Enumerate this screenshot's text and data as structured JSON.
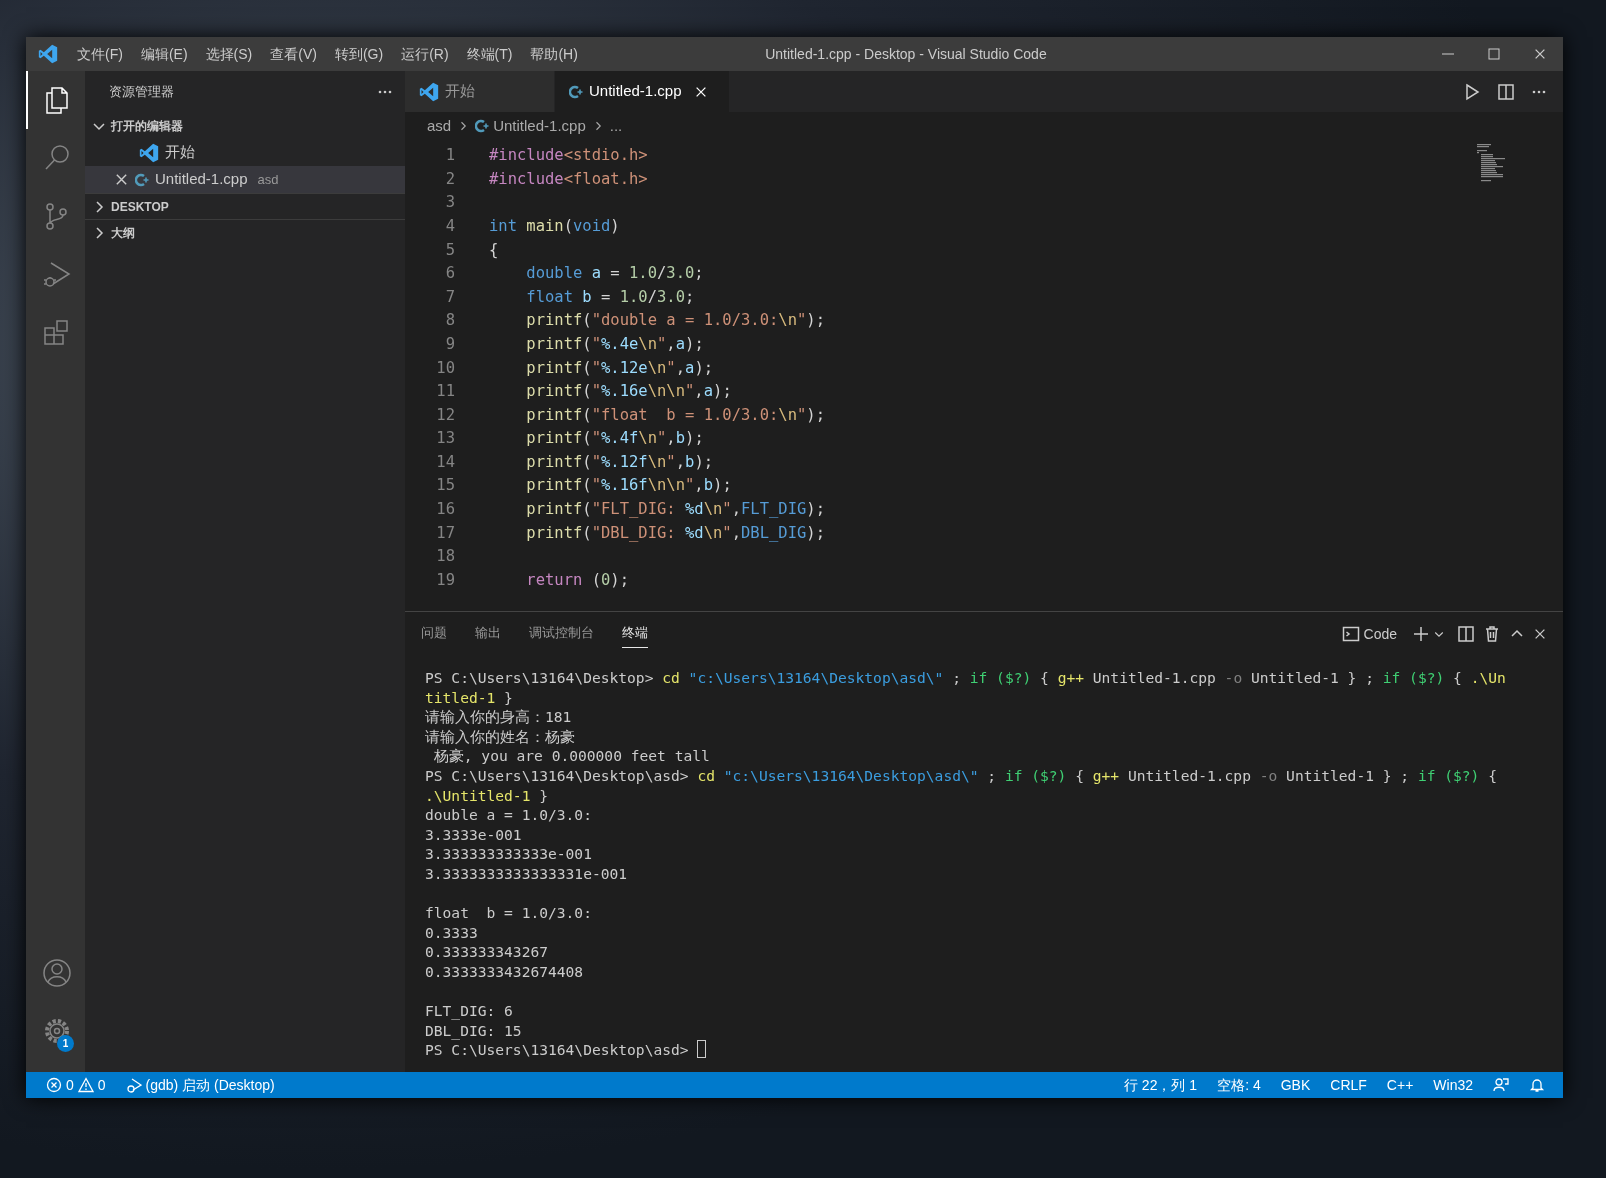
{
  "window": {
    "title": "Untitled-1.cpp - Desktop - Visual Studio Code"
  },
  "menu": [
    "文件(F)",
    "编辑(E)",
    "选择(S)",
    "查看(V)",
    "转到(G)",
    "运行(R)",
    "终端(T)",
    "帮助(H)"
  ],
  "activity_bar": {
    "top": [
      {
        "selected": true
      },
      {
        "selected": false
      },
      {
        "selected": false
      },
      {
        "selected": false
      },
      {
        "selected": false
      }
    ],
    "bottom": [
      {
        "selected": false
      },
      {
        "selected": false,
        "badge": "1"
      }
    ]
  },
  "sidebar": {
    "title": "资源管理器",
    "sections": [
      {
        "label": "打开的编辑器",
        "expanded": true,
        "items": [
          {
            "label": "开始",
            "kind": "welcome",
            "selected": false
          },
          {
            "label": "Untitled-1.cpp",
            "description": "asd",
            "kind": "cpp",
            "selected": true
          }
        ]
      },
      {
        "label": "DESKTOP",
        "expanded": false
      },
      {
        "label": "大纲",
        "expanded": false
      }
    ]
  },
  "tabs": [
    {
      "label": "开始",
      "kind": "welcome",
      "selected": false
    },
    {
      "label": "Untitled-1.cpp",
      "kind": "cpp",
      "selected": true
    }
  ],
  "breadcrumb": [
    {
      "text": "asd",
      "kind": "folder"
    },
    {
      "text": "Untitled-1.cpp",
      "kind": "cpp"
    },
    {
      "text": "...",
      "kind": "symbol"
    }
  ],
  "editor": {
    "lines": [
      {
        "number": "1",
        "tokens": [
          {
            "kind": "pre",
            "text": "#include"
          },
          {
            "kind": "str",
            "text": "<stdio.h>"
          }
        ]
      },
      {
        "number": "2",
        "tokens": [
          {
            "kind": "pre",
            "text": "#include"
          },
          {
            "kind": "str",
            "text": "<float.h>"
          }
        ]
      },
      {
        "number": "3"
      },
      {
        "number": "4",
        "tokens": [
          {
            "kind": "kw",
            "text": "int"
          },
          {
            "kind": "fn",
            "text": " main"
          },
          {
            "kind": "plain",
            "text": "("
          },
          {
            "kind": "kw",
            "text": "void"
          },
          {
            "kind": "plain",
            "text": ")"
          }
        ]
      },
      {
        "number": "5",
        "tokens": [
          {
            "kind": "plain",
            "text": "{"
          }
        ]
      },
      {
        "number": "6",
        "tokens": [
          {
            "kind": "kw",
            "text": "    double"
          },
          {
            "kind": "var",
            "text": " a"
          },
          {
            "kind": "plain",
            "text": " = "
          },
          {
            "kind": "num",
            "text": "1.0"
          },
          {
            "kind": "plain",
            "text": "/"
          },
          {
            "kind": "num",
            "text": "3.0"
          },
          {
            "kind": "plain",
            "text": ";"
          }
        ]
      },
      {
        "number": "7",
        "tokens": [
          {
            "kind": "kw",
            "text": "    float"
          },
          {
            "kind": "var",
            "text": " b"
          },
          {
            "kind": "plain",
            "text": " = "
          },
          {
            "kind": "num",
            "text": "1.0"
          },
          {
            "kind": "plain",
            "text": "/"
          },
          {
            "kind": "num",
            "text": "3.0"
          },
          {
            "kind": "plain",
            "text": ";"
          }
        ]
      },
      {
        "number": "8",
        "tokens": [
          {
            "kind": "fn",
            "text": "    printf"
          },
          {
            "kind": "plain",
            "text": "("
          },
          {
            "kind": "str",
            "text": "\"double a = 1.0/3.0:"
          },
          {
            "kind": "esc",
            "text": "\\n"
          },
          {
            "kind": "str",
            "text": "\""
          },
          {
            "kind": "plain",
            "text": ");"
          }
        ]
      },
      {
        "number": "9",
        "tokens": [
          {
            "kind": "fn",
            "text": "    printf"
          },
          {
            "kind": "plain",
            "text": "("
          },
          {
            "kind": "str",
            "text": "\""
          },
          {
            "kind": "fmt",
            "text": "%.4e"
          },
          {
            "kind": "esc",
            "text": "\\n"
          },
          {
            "kind": "str",
            "text": "\""
          },
          {
            "kind": "plain",
            "text": ","
          },
          {
            "kind": "var",
            "text": "a"
          },
          {
            "kind": "plain",
            "text": ");"
          }
        ]
      },
      {
        "number": "10",
        "tokens": [
          {
            "kind": "fn",
            "text": "    printf"
          },
          {
            "kind": "plain",
            "text": "("
          },
          {
            "kind": "str",
            "text": "\""
          },
          {
            "kind": "fmt",
            "text": "%.12e"
          },
          {
            "kind": "esc",
            "text": "\\n"
          },
          {
            "kind": "str",
            "text": "\""
          },
          {
            "kind": "plain",
            "text": ","
          },
          {
            "kind": "var",
            "text": "a"
          },
          {
            "kind": "plain",
            "text": ");"
          }
        ]
      },
      {
        "number": "11",
        "tokens": [
          {
            "kind": "fn",
            "text": "    printf"
          },
          {
            "kind": "plain",
            "text": "("
          },
          {
            "kind": "str",
            "text": "\""
          },
          {
            "kind": "fmt",
            "text": "%.16e"
          },
          {
            "kind": "esc",
            "text": "\\n\\n"
          },
          {
            "kind": "str",
            "text": "\""
          },
          {
            "kind": "plain",
            "text": ","
          },
          {
            "kind": "var",
            "text": "a"
          },
          {
            "kind": "plain",
            "text": ");"
          }
        ]
      },
      {
        "number": "12",
        "tokens": [
          {
            "kind": "fn",
            "text": "    printf"
          },
          {
            "kind": "plain",
            "text": "("
          },
          {
            "kind": "str",
            "text": "\"float  b = 1.0/3.0:"
          },
          {
            "kind": "esc",
            "text": "\\n"
          },
          {
            "kind": "str",
            "text": "\""
          },
          {
            "kind": "plain",
            "text": ");"
          }
        ]
      },
      {
        "number": "13",
        "tokens": [
          {
            "kind": "fn",
            "text": "    printf"
          },
          {
            "kind": "plain",
            "text": "("
          },
          {
            "kind": "str",
            "text": "\""
          },
          {
            "kind": "fmt",
            "text": "%.4f"
          },
          {
            "kind": "esc",
            "text": "\\n"
          },
          {
            "kind": "str",
            "text": "\""
          },
          {
            "kind": "plain",
            "text": ","
          },
          {
            "kind": "var",
            "text": "b"
          },
          {
            "kind": "plain",
            "text": ");"
          }
        ]
      },
      {
        "number": "14",
        "tokens": [
          {
            "kind": "fn",
            "text": "    printf"
          },
          {
            "kind": "plain",
            "text": "("
          },
          {
            "kind": "str",
            "text": "\""
          },
          {
            "kind": "fmt",
            "text": "%.12f"
          },
          {
            "kind": "esc",
            "text": "\\n"
          },
          {
            "kind": "str",
            "text": "\""
          },
          {
            "kind": "plain",
            "text": ","
          },
          {
            "kind": "var",
            "text": "b"
          },
          {
            "kind": "plain",
            "text": ");"
          }
        ]
      },
      {
        "number": "15",
        "tokens": [
          {
            "kind": "fn",
            "text": "    printf"
          },
          {
            "kind": "plain",
            "text": "("
          },
          {
            "kind": "str",
            "text": "\""
          },
          {
            "kind": "fmt",
            "text": "%.16f"
          },
          {
            "kind": "esc",
            "text": "\\n\\n"
          },
          {
            "kind": "str",
            "text": "\""
          },
          {
            "kind": "plain",
            "text": ","
          },
          {
            "kind": "var",
            "text": "b"
          },
          {
            "kind": "plain",
            "text": ");"
          }
        ]
      },
      {
        "number": "16",
        "tokens": [
          {
            "kind": "fn",
            "text": "    printf"
          },
          {
            "kind": "plain",
            "text": "("
          },
          {
            "kind": "str",
            "text": "\"FLT_DIG: "
          },
          {
            "kind": "fmt",
            "text": "%d"
          },
          {
            "kind": "esc",
            "text": "\\n"
          },
          {
            "kind": "str",
            "text": "\""
          },
          {
            "kind": "plain",
            "text": ","
          },
          {
            "kind": "macro",
            "text": "FLT_DIG"
          },
          {
            "kind": "plain",
            "text": ");"
          }
        ]
      },
      {
        "number": "17",
        "tokens": [
          {
            "kind": "fn",
            "text": "    printf"
          },
          {
            "kind": "plain",
            "text": "("
          },
          {
            "kind": "str",
            "text": "\"DBL_DIG: "
          },
          {
            "kind": "fmt",
            "text": "%d"
          },
          {
            "kind": "esc",
            "text": "\\n"
          },
          {
            "kind": "str",
            "text": "\""
          },
          {
            "kind": "plain",
            "text": ","
          },
          {
            "kind": "macro",
            "text": "DBL_DIG"
          },
          {
            "kind": "plain",
            "text": ");"
          }
        ]
      },
      {
        "number": "18"
      },
      {
        "number": "19",
        "tokens": [
          {
            "kind": "ctl",
            "text": "    return"
          },
          {
            "kind": "plain",
            "text": " ("
          },
          {
            "kind": "num",
            "text": "0"
          },
          {
            "kind": "plain",
            "text": ");"
          }
        ]
      }
    ]
  },
  "panel": {
    "tabs": [
      {
        "label": "问题",
        "selected": false
      },
      {
        "label": "输出",
        "selected": false
      },
      {
        "label": "调试控制台",
        "selected": false
      },
      {
        "label": "终端",
        "selected": true
      }
    ],
    "terminal_name": "Code",
    "terminal": {
      "cursor_visible": true,
      "lines": [
        {
          "kind": "text",
          "segments": [
            {
              "kind": "plain",
              "text": "PS C:\\Users\\13164\\Desktop> "
            },
            {
              "kind": "cmd",
              "text": "cd"
            },
            {
              "kind": "str",
              "text": " \"c:\\Users\\13164\\Desktop\\asd\\\""
            },
            {
              "kind": "plain",
              "text": " ; "
            },
            {
              "kind": "kw",
              "text": "if ($?)"
            },
            {
              "kind": "plain",
              "text": " { "
            },
            {
              "kind": "cmd",
              "text": "g++"
            },
            {
              "kind": "plain",
              "text": " Untitled-1.cpp "
            },
            {
              "kind": "dim",
              "text": "-o"
            },
            {
              "kind": "plain",
              "text": " Untitled-1 } ; "
            },
            {
              "kind": "kw",
              "text": "if ($?)"
            },
            {
              "kind": "plain",
              "text": " { "
            },
            {
              "kind": "cmd",
              "text": ".\\Un"
            }
          ]
        },
        {
          "kind": "text",
          "segments": [
            {
              "kind": "cmd",
              "text": "titled-1"
            },
            {
              "kind": "plain",
              "text": " }"
            }
          ]
        },
        {
          "kind": "text",
          "segments": [
            {
              "kind": "plain",
              "text": "请输入你的身高：181"
            }
          ]
        },
        {
          "kind": "text",
          "segments": [
            {
              "kind": "plain",
              "text": "请输入你的姓名：杨豪"
            }
          ]
        },
        {
          "kind": "text",
          "segments": [
            {
              "kind": "plain",
              "text": " 杨豪, you are 0.000000 feet tall"
            }
          ]
        },
        {
          "kind": "text",
          "segments": [
            {
              "kind": "plain",
              "text": "PS C:\\Users\\13164\\Desktop\\asd> "
            },
            {
              "kind": "cmd",
              "text": "cd"
            },
            {
              "kind": "str",
              "text": " \"c:\\Users\\13164\\Desktop\\asd\\\""
            },
            {
              "kind": "plain",
              "text": " ; "
            },
            {
              "kind": "kw",
              "text": "if ($?)"
            },
            {
              "kind": "plain",
              "text": " { "
            },
            {
              "kind": "cmd",
              "text": "g++"
            },
            {
              "kind": "plain",
              "text": " Untitled-1.cpp "
            },
            {
              "kind": "dim",
              "text": "-o"
            },
            {
              "kind": "plain",
              "text": " Untitled-1 } ; "
            },
            {
              "kind": "kw",
              "text": "if ($?)"
            },
            {
              "kind": "plain",
              "text": " {"
            }
          ]
        },
        {
          "kind": "text",
          "segments": [
            {
              "kind": "cmd",
              "text": ".\\Untitled-1"
            },
            {
              "kind": "plain",
              "text": " }"
            }
          ]
        },
        {
          "kind": "text",
          "segments": [
            {
              "kind": "plain",
              "text": "double a = 1.0/3.0:"
            }
          ]
        },
        {
          "kind": "text",
          "segments": [
            {
              "kind": "plain",
              "text": "3.3333e-001"
            }
          ]
        },
        {
          "kind": "text",
          "segments": [
            {
              "kind": "plain",
              "text": "3.333333333333e-001"
            }
          ]
        },
        {
          "kind": "text",
          "segments": [
            {
              "kind": "plain",
              "text": "3.3333333333333331e-001"
            }
          ]
        },
        {
          "kind": "blank"
        },
        {
          "kind": "text",
          "segments": [
            {
              "kind": "plain",
              "text": "float  b = 1.0/3.0:"
            }
          ]
        },
        {
          "kind": "text",
          "segments": [
            {
              "kind": "plain",
              "text": "0.3333"
            }
          ]
        },
        {
          "kind": "text",
          "segments": [
            {
              "kind": "plain",
              "text": "0.333333343267"
            }
          ]
        },
        {
          "kind": "text",
          "segments": [
            {
              "kind": "plain",
              "text": "0.3333333432674408"
            }
          ]
        },
        {
          "kind": "blank"
        },
        {
          "kind": "text",
          "segments": [
            {
              "kind": "plain",
              "text": "FLT_DIG: 6"
            }
          ]
        },
        {
          "kind": "text",
          "segments": [
            {
              "kind": "plain",
              "text": "DBL_DIG: 15"
            }
          ]
        },
        {
          "kind": "text",
          "segments": [
            {
              "kind": "plain",
              "text": "PS C:\\Users\\13164\\Desktop\\asd> "
            }
          ]
        }
      ]
    }
  },
  "status_bar": {
    "errors": "0",
    "warnings": "0",
    "debug": "(gdb) 启动 (Desktop)",
    "items": [
      "行 22，列 1",
      "空格: 4",
      "GBK",
      "CRLF",
      "C++",
      "Win32"
    ]
  }
}
